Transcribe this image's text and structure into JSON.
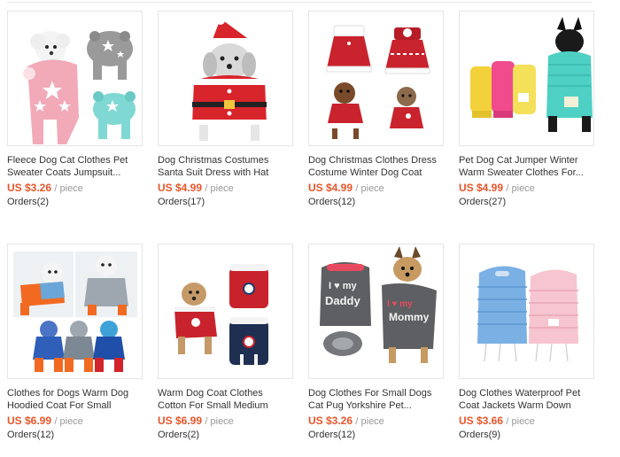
{
  "products": [
    {
      "title": "Fleece Dog Cat Clothes Pet Sweater Coats Jumpsuit...",
      "price": "US $3.26",
      "unit": "/ piece",
      "orders": "Orders(2)",
      "image": "pink-grey-fleece-jumpsuits-image"
    },
    {
      "title": "Dog Christmas Costumes Santa Suit Dress with Hat For...",
      "price": "US $4.99",
      "unit": "/ piece",
      "orders": "Orders(17)",
      "image": "santa-suit-dog-image"
    },
    {
      "title": "Dog Christmas Clothes Dress Costume Winter Dog Coat For...",
      "price": "US $4.99",
      "unit": "/ piece",
      "orders": "Orders(12)",
      "image": "christmas-dresses-image"
    },
    {
      "title": "Pet Dog Cat Jumper Winter Warm Sweater Clothes For...",
      "price": "US $4.99",
      "unit": "/ piece",
      "orders": "Orders(27)",
      "image": "knit-sweaters-image"
    },
    {
      "title": "Clothes for Dogs Warm Dog Hoodied Coat For Small Medium...",
      "price": "US $6.99",
      "unit": "/ piece",
      "orders": "Orders(12)",
      "image": "hooded-coats-image"
    },
    {
      "title": "Warm Dog Coat Clothes Cotton For Small Medium Large Dogs...",
      "price": "US $6.99",
      "unit": "/ piece",
      "orders": "Orders(2)",
      "image": "cotton-coats-image"
    },
    {
      "title": "Dog Clothes For Small Dogs Cat Pug Yorkshire Pet...",
      "price": "US $3.26",
      "unit": "/ piece",
      "orders": "Orders(12)",
      "image": "i-love-daddy-sweater-image"
    },
    {
      "title": "Dog Clothes Waterproof Pet Coat Jackets Warm Down Jacket...",
      "price": "US $3.66",
      "unit": "/ piece",
      "orders": "Orders(9)",
      "image": "down-jackets-image"
    }
  ],
  "graphics": {
    "img7_text1": "I ♥ my",
    "img7_text2": "Daddy",
    "img7_text3": "I ♥ my",
    "img7_text4": "Mommy"
  },
  "colors": {
    "price": "#e8552a",
    "border": "#e5e5e5"
  }
}
